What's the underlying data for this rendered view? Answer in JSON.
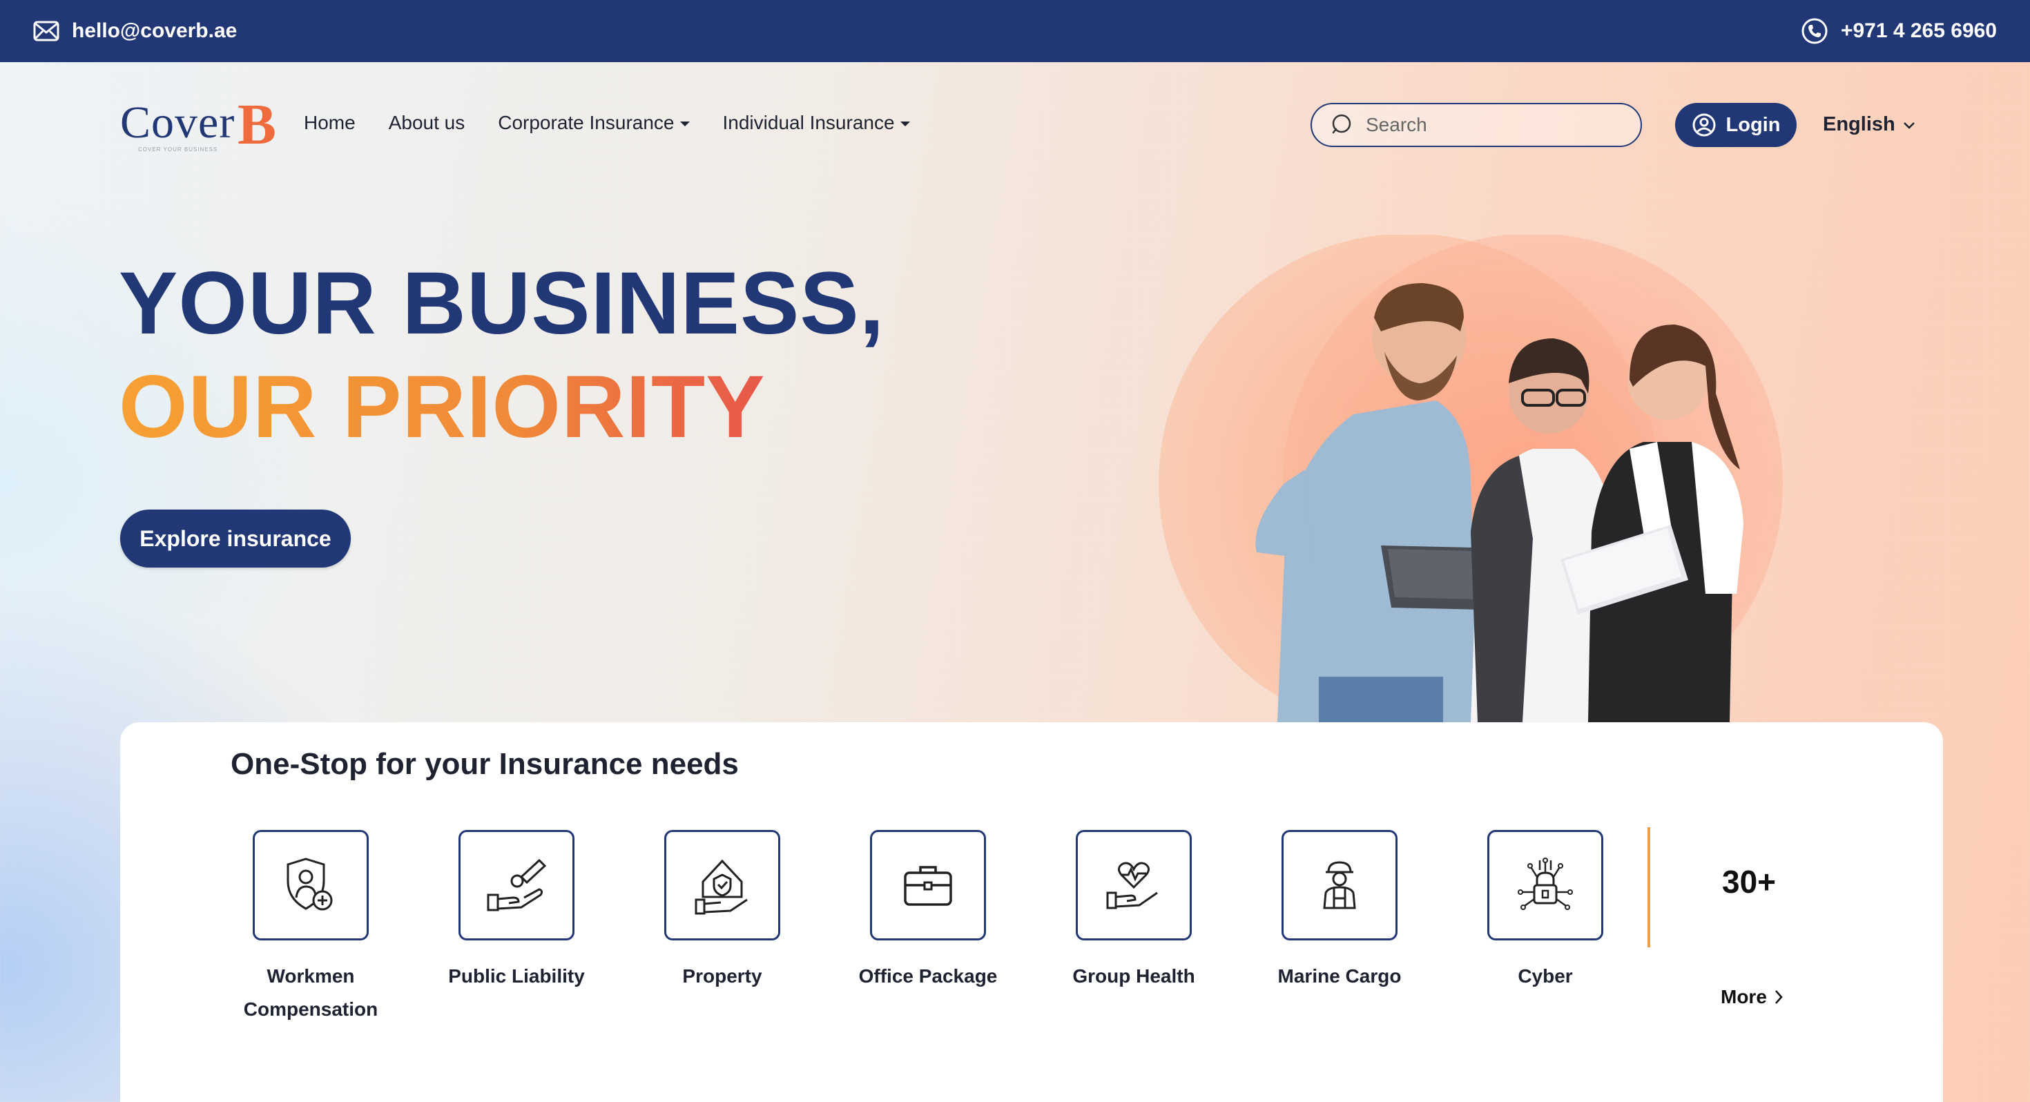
{
  "topbar": {
    "email": "hello@coverb.ae",
    "phone": "+971 4 265 6960",
    "background": "#213776"
  },
  "brand": {
    "logo_word": "Cover",
    "logo_letter": "B",
    "logo_tagline": "COVER YOUR BUSINESS"
  },
  "nav": {
    "items": [
      {
        "label": "Home"
      },
      {
        "label": "About us"
      },
      {
        "label": "Corporate Insurance"
      },
      {
        "label": "Individual Insurance"
      }
    ],
    "search_placeholder": "Search",
    "login_label": "Login",
    "language": "English"
  },
  "hero": {
    "line1": "YOUR BUSINESS,",
    "line2": "OUR PRIORITY",
    "cta_label": "Explore insurance"
  },
  "services": {
    "title": "One-Stop for your Insurance needs",
    "items": [
      {
        "label": "Workmen Compensation",
        "icon": "shield-worker-icon"
      },
      {
        "label": "Public Liability",
        "icon": "hand-coin-icon"
      },
      {
        "label": "Property",
        "icon": "house-hand-icon"
      },
      {
        "label": "Office Package",
        "icon": "briefcase-icon"
      },
      {
        "label": "Group Health",
        "icon": "heart-hand-icon"
      },
      {
        "label": "Marine Cargo",
        "icon": "cargo-worker-icon"
      },
      {
        "label": "Cyber",
        "icon": "circuit-lock-icon"
      }
    ],
    "more_count": "30+",
    "more_label": "More"
  },
  "colors": {
    "primary": "#213776",
    "accent_orange": "#f7a033",
    "accent_red": "#e8564a"
  }
}
